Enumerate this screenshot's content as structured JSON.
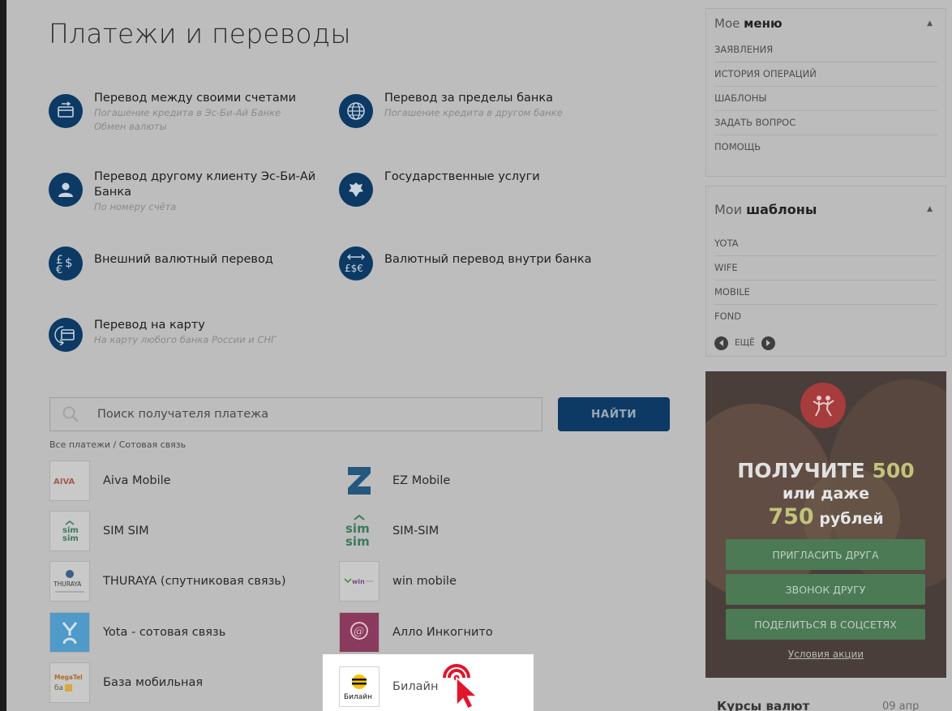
{
  "page_title": "Платежи и переводы",
  "services": [
    {
      "title": "Перевод между своими счетами",
      "subs": [
        "Погашение кредита в Эс-Би-Ай Банке",
        "Обмен валюты"
      ],
      "icon": "transfer-card-icon"
    },
    {
      "title": "Перевод за пределы банка",
      "subs": [
        "Погашение кредита в другом банке"
      ],
      "icon": "globe-icon"
    },
    {
      "title": "Перевод другому клиенту Эс-Би-Ай Банка",
      "subs": [
        "По номеру счёта"
      ],
      "icon": "user-icon"
    },
    {
      "title": "Государственные услуги",
      "subs": [],
      "icon": "coat-of-arms-icon"
    },
    {
      "title": "Внешний валютный перевод",
      "subs": [],
      "icon": "currency-icon"
    },
    {
      "title": "Валютный перевод внутри банка",
      "subs": [],
      "icon": "currency-exchange-icon"
    },
    {
      "title": "Перевод на карту",
      "subs": [
        "На карту любого банка России и СНГ"
      ],
      "icon": "card-arrow-icon"
    }
  ],
  "search": {
    "placeholder": "Поиск получателя платежа",
    "button": "НАЙТИ"
  },
  "breadcrumb": "Все платежи / Сотовая связь",
  "operators": [
    {
      "name": "Aiva Mobile",
      "logo_text": "AIVA"
    },
    {
      "name": "EZ Mobile",
      "logo_text": "EZ"
    },
    {
      "name": "SIM SIM",
      "logo_text": "sim sim"
    },
    {
      "name": "SIM-SIM",
      "logo_text": "sim sim"
    },
    {
      "name": "THURAYA (спутниковая связь)",
      "logo_text": "THURAYA"
    },
    {
      "name": "win mobile",
      "logo_text": "win"
    },
    {
      "name": "Yota - сотовая связь",
      "logo_text": "Y"
    },
    {
      "name": "Алло Инкогнито",
      "logo_text": "@"
    },
    {
      "name": "База мобильная",
      "logo_text": "MegaTel"
    },
    {
      "name": "Билайн",
      "logo_text": "Билайн"
    }
  ],
  "sidebar": {
    "menu": {
      "title_plain": "Мое",
      "title_bold": "меню",
      "items": [
        "ЗАЯВЛЕНИЯ",
        "ИСТОРИЯ ОПЕРАЦИЙ",
        "ШАБЛОНЫ",
        "ЗАДАТЬ ВОПРОС",
        "ПОМОЩЬ"
      ]
    },
    "templates": {
      "title_plain": "Мои",
      "title_bold": "шаблоны",
      "items": [
        "YOTA",
        "WIFE",
        "MOBILE",
        "FOND"
      ],
      "more_label": "ЕЩЁ"
    },
    "promo": {
      "line1_a": "ПОЛУЧИТЕ",
      "line1_num": "500",
      "line2": "или даже",
      "line3_num": "750",
      "line3_b": "рублей",
      "buttons": [
        "ПРИГЛАСИТЬ ДРУГА",
        "ЗВОНОК ДРУГУ",
        "ПОДЕЛИТЬСЯ В СОЦСЕТЯХ"
      ],
      "link": "Условия акции"
    },
    "rates_title": "Курсы валют",
    "rates_date": "09 апр"
  },
  "colors": {
    "accent": "#0c3a64",
    "overlay": "#bdbdbd",
    "cursor": "#e0162b",
    "promo_green": "#4b7a55"
  }
}
